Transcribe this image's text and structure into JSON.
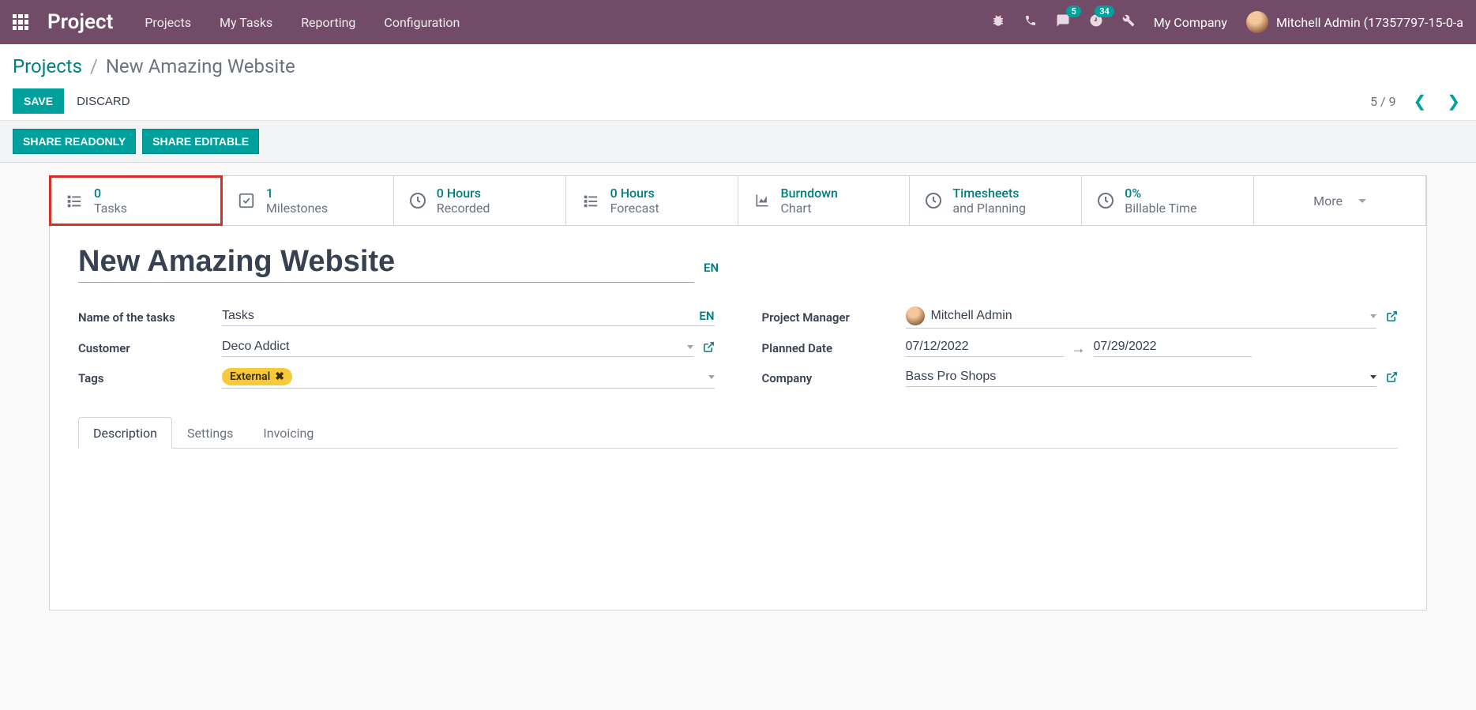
{
  "topbar": {
    "brand": "Project",
    "menu": [
      "Projects",
      "My Tasks",
      "Reporting",
      "Configuration"
    ],
    "conversations_badge": "5",
    "activities_badge": "34",
    "company": "My Company",
    "user": "Mitchell Admin (17357797-15-0-a"
  },
  "breadcrumb": {
    "parent": "Projects",
    "current": "New Amazing Website"
  },
  "actions": {
    "save": "SAVE",
    "discard": "DISCARD",
    "share_readonly": "SHARE READONLY",
    "share_editable": "SHARE EDITABLE"
  },
  "pager": {
    "text": "5 / 9"
  },
  "stats": [
    {
      "value": "0",
      "label": "Tasks"
    },
    {
      "value": "1",
      "label": "Milestones"
    },
    {
      "value": "0 Hours",
      "label": "Recorded"
    },
    {
      "value": "0 Hours",
      "label": "Forecast"
    },
    {
      "value": "Burndown",
      "label": "Chart"
    },
    {
      "value": "Timesheets",
      "label": "and Planning"
    },
    {
      "value": "0%",
      "label": "Billable Time"
    }
  ],
  "more_label": "More",
  "form": {
    "title": "New Amazing Website",
    "lang": "EN",
    "labels": {
      "tasks_name": "Name of the tasks",
      "customer": "Customer",
      "tags": "Tags",
      "project_manager": "Project Manager",
      "planned_date": "Planned Date",
      "company": "Company"
    },
    "values": {
      "tasks_name": "Tasks",
      "customer": "Deco Addict",
      "tag": "External",
      "project_manager": "Mitchell Admin",
      "date_start": "07/12/2022",
      "date_end": "07/29/2022",
      "company": "Bass Pro Shops"
    }
  },
  "tabs": [
    "Description",
    "Settings",
    "Invoicing"
  ]
}
